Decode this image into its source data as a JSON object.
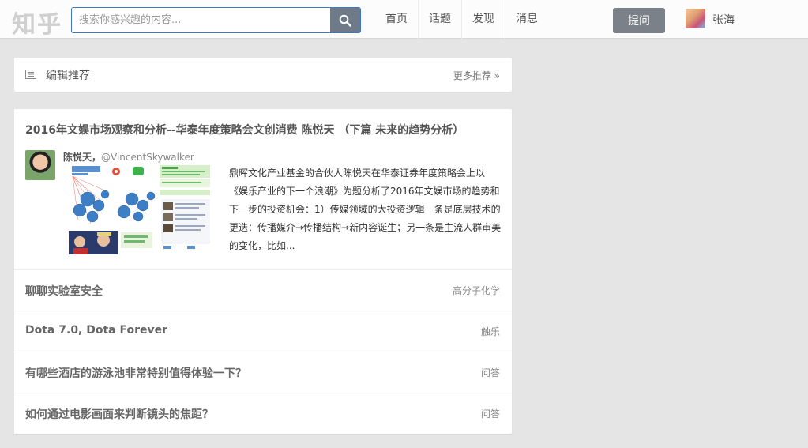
{
  "header": {
    "logo": "知乎",
    "search_placeholder": "搜索你感兴趣的内容...",
    "nav": [
      {
        "label": "首页"
      },
      {
        "label": "话题"
      },
      {
        "label": "发现"
      },
      {
        "label": "消息"
      }
    ],
    "ask_label": "提问",
    "user_name": "张海"
  },
  "editor_pick": {
    "title": "编辑推荐",
    "more_label": "更多推荐 »"
  },
  "feature": {
    "title": "2016年文娱市场观察和分析--华泰年度策略会文创消费 陈悦天 （下篇 未来的趋势分析）",
    "author_name": "陈悦天",
    "author_sep": "，",
    "author_handle": "@VincentSkywalker",
    "excerpt": "鼎晖文化产业基金的合伙人陈悦天在华泰证券年度策略会上以《娱乐产业的下一个浪潮》为题分析了2016年文娱市场的趋势和下一步的投资机会：1）传媒领域的大投资逻辑一条是底层技术的更迭：传播媒介→传播结构→新内容诞生；另一条是主流人群审美的变化，比如..."
  },
  "items": [
    {
      "title": "聊聊实验室安全",
      "tag": "高分子化学"
    },
    {
      "title": "Dota 7.0, Dota Forever",
      "tag": "触乐"
    },
    {
      "title": "有哪些酒店的游泳池非常特别值得体验一下？",
      "tag": "问答"
    },
    {
      "title": "如何通过电影画面来判断镜头的焦距？",
      "tag": "问答"
    }
  ],
  "colors": {
    "accent": "#3c78c8",
    "search_button": "#6e7a87",
    "ask_button": "#7b8188",
    "page_bg": "#e5e5e5"
  },
  "icons": [
    "search-icon",
    "list-icon"
  ]
}
